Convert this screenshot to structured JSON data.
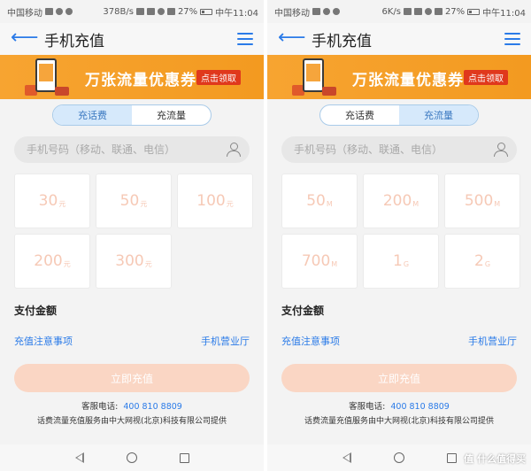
{
  "screens": [
    {
      "status": {
        "carrier": "中国移动",
        "speed": "378B/s",
        "battery": "27%",
        "time": "中午11:04"
      },
      "title": "手机充值",
      "banner": {
        "text": "万张流量优惠券",
        "button": "点击领取"
      },
      "tabs": [
        {
          "label": "充话费",
          "active": true
        },
        {
          "label": "充流量",
          "active": false
        }
      ],
      "phone_placeholder": "手机号码（移动、联通、电信）",
      "amounts": [
        {
          "value": "30",
          "unit": "元"
        },
        {
          "value": "50",
          "unit": "元"
        },
        {
          "value": "100",
          "unit": "元"
        },
        {
          "value": "200",
          "unit": "元"
        },
        {
          "value": "300",
          "unit": "元"
        }
      ],
      "pay_label": "支付金额",
      "link_notes": "充值注意事项",
      "link_store": "手机营业厅",
      "submit": "立即充值",
      "service_label": "客服电话:",
      "service_phone": "400 810 8809",
      "provider": "话费流量充值服务由中大网视(北京)科技有限公司提供"
    },
    {
      "status": {
        "carrier": "中国移动",
        "speed": "6K/s",
        "battery": "27%",
        "time": "中午11:04"
      },
      "title": "手机充值",
      "banner": {
        "text": "万张流量优惠券",
        "button": "点击领取"
      },
      "tabs": [
        {
          "label": "充话费",
          "active": false
        },
        {
          "label": "充流量",
          "active": true
        }
      ],
      "phone_placeholder": "手机号码（移动、联通、电信）",
      "amounts": [
        {
          "value": "50",
          "unit": "M"
        },
        {
          "value": "200",
          "unit": "M"
        },
        {
          "value": "500",
          "unit": "M"
        },
        {
          "value": "700",
          "unit": "M"
        },
        {
          "value": "1",
          "unit": "G"
        },
        {
          "value": "2",
          "unit": "G"
        }
      ],
      "pay_label": "支付金额",
      "link_notes": "充值注意事项",
      "link_store": "手机营业厅",
      "submit": "立即充值",
      "service_label": "客服电话:",
      "service_phone": "400 810 8809",
      "provider": "话费流量充值服务由中大网视(北京)科技有限公司提供"
    }
  ],
  "watermark": "值 什么值得买",
  "colors": {
    "accent": "#2b7be8",
    "banner": "#f39a20",
    "amount_text": "#f6c9b6",
    "submit_bg": "#fad6c4"
  }
}
